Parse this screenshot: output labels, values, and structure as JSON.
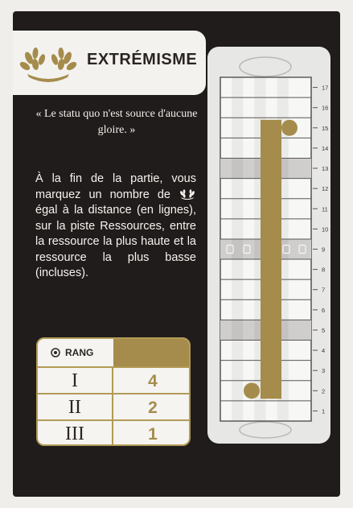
{
  "card": {
    "title": "EXTRÉMISME",
    "quote": "« Le statu quo n'est source d'aucune gloire. »",
    "rule_part1": "À la fin de la partie, vous marquez un nombre de",
    "rule_part2": "égal à la distance (en lignes), sur la piste Ressources, entre la ressource la plus haute et la ressource la plus basse (incluses)."
  },
  "rank_table": {
    "header_label": "RANG",
    "rows": [
      {
        "rank": "I",
        "points": "4"
      },
      {
        "rank": "II",
        "points": "2"
      },
      {
        "rank": "III",
        "points": "1"
      }
    ]
  },
  "track": {
    "numbers": [
      "1",
      "2",
      "3",
      "4",
      "5",
      "6",
      "7",
      "8",
      "9",
      "10",
      "11",
      "12",
      "13",
      "14",
      "15",
      "16",
      "17"
    ],
    "resource_icons": [
      "scroll-icon",
      "gem-icon",
      "quill-icon",
      "scroll-icon"
    ],
    "high_marker_row": 15,
    "low_marker_row": 2
  },
  "colors": {
    "gold": "#a58c4c",
    "dark": "#1f1c1b",
    "light": "#efeeea"
  }
}
